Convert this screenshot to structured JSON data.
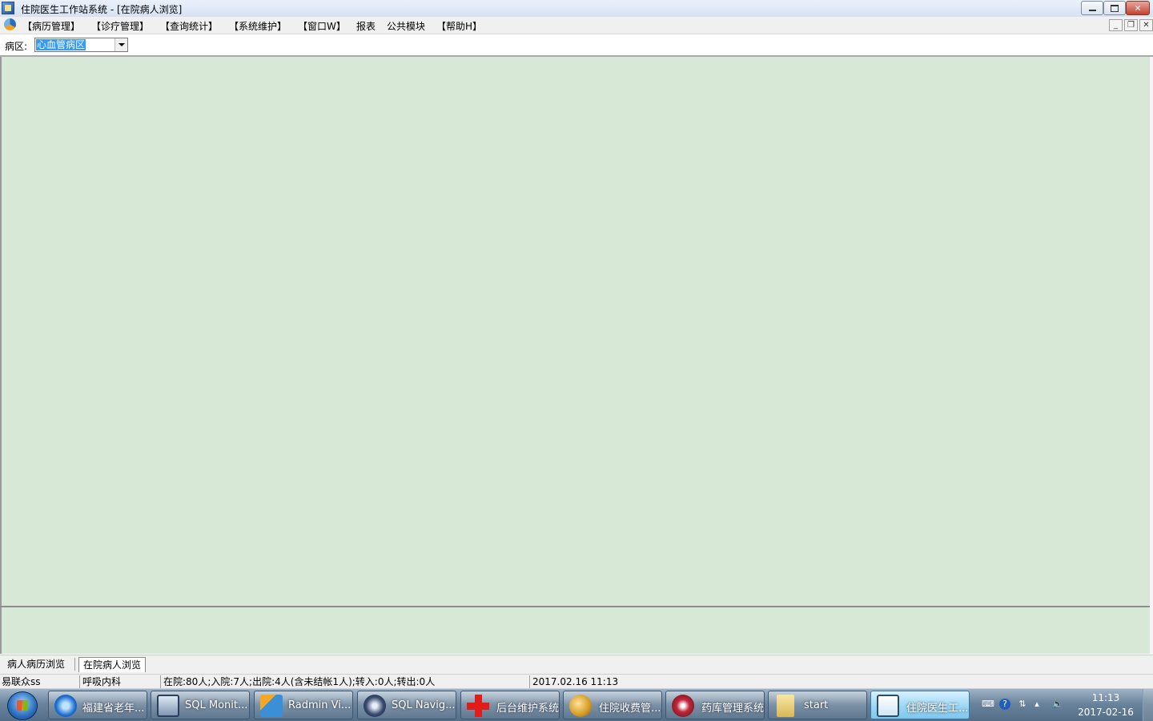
{
  "window": {
    "title": "住院医生工作站系统 - [在院病人浏览]"
  },
  "menubar": {
    "items": [
      "【病历管理】",
      "【诊疗管理】",
      "【查询统计】",
      "【系统维护】",
      "【窗口W】",
      "报表",
      "公共模块",
      "【帮助H】"
    ]
  },
  "ward": {
    "label": "病区:",
    "selected": "心血管病区"
  },
  "window_tabs": {
    "items": [
      "病人病历浏览",
      "在院病人浏览"
    ],
    "active_index": 1
  },
  "statusbar": {
    "user": "易联众ss",
    "department": "呼吸内科",
    "summary": "在院:80人;入院:7人;出院:4人(含未结帐1人);转入:0人;转出:0人",
    "datetime": "2017.02.16 11:13"
  },
  "taskbar": {
    "buttons": [
      {
        "label": "福建省老年...",
        "icon": "ie-icon"
      },
      {
        "label": "SQL Monit...",
        "icon": "sql-monitor-icon"
      },
      {
        "label": "Radmin Vi...",
        "icon": "radmin-icon"
      },
      {
        "label": "SQL Navig...",
        "icon": "sql-navigator-icon"
      },
      {
        "label": "后台维护系统",
        "icon": "red-cross-icon"
      },
      {
        "label": "住院收费管...",
        "icon": "billing-icon"
      },
      {
        "label": "药库管理系统",
        "icon": "pharmacy-icon"
      },
      {
        "label": "start",
        "icon": "folder-icon"
      },
      {
        "label": "住院医生工...",
        "icon": "doctor-workstation-icon"
      }
    ],
    "active_index": 8,
    "clock": {
      "time": "11:13",
      "date": "2017-02-16"
    }
  },
  "colors": {
    "client_background": "#d7e8d7",
    "selection": "#3399ff"
  }
}
